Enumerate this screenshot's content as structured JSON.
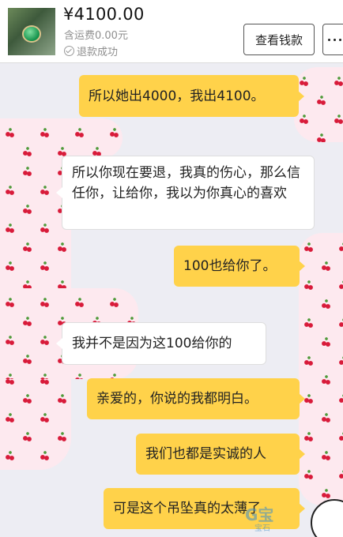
{
  "order": {
    "price": "¥4100.00",
    "shipping": "含运费0.00元",
    "status": "退款成功"
  },
  "actions": {
    "wallet_label": "查看钱款"
  },
  "messages": [
    {
      "side": "right",
      "text": "所以她出4000，我出4100。"
    },
    {
      "side": "left",
      "text": "所以你现在要退，我真的伤心，那么信任你，让给你，我以为你真心的喜欢"
    },
    {
      "side": "right",
      "text": "100也给你了。"
    },
    {
      "side": "left",
      "text": "我并不是因为这100给你的"
    },
    {
      "side": "right",
      "text": "亲爱的，你说的我都明白。"
    },
    {
      "side": "right",
      "text": "我们也都是实诚的人"
    },
    {
      "side": "right",
      "text": "可是这个吊坠真的太薄了"
    }
  ],
  "watermark": {
    "main": "G宝",
    "sub": "宝石"
  },
  "colors": {
    "outgoing_bubble": "#ffd24a",
    "incoming_bubble": "#ffffff",
    "chat_background": "#ededf3"
  }
}
